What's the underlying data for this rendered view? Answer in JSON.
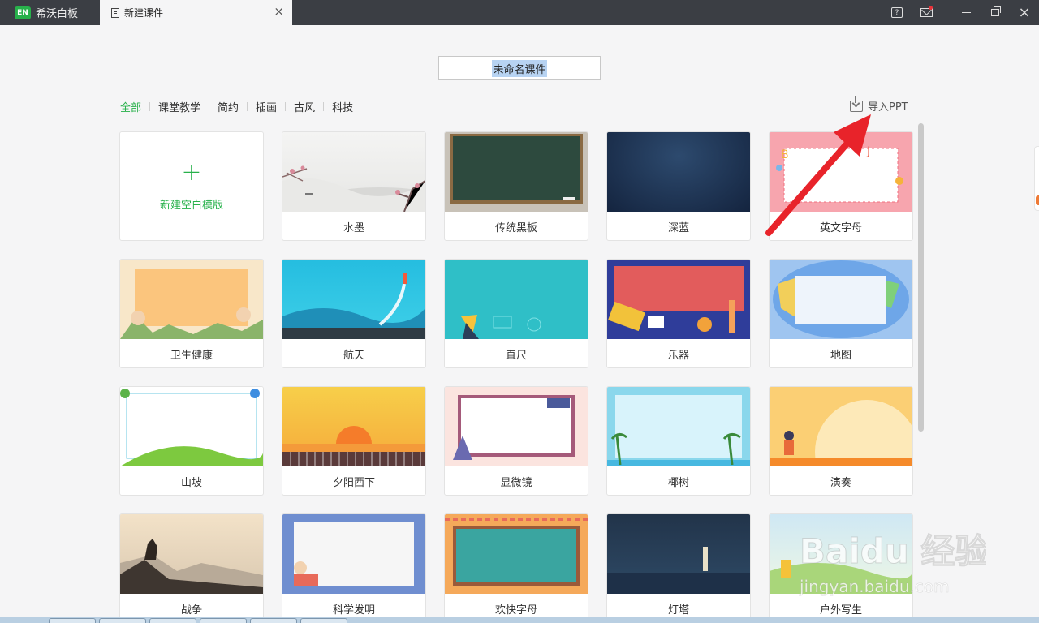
{
  "titlebar": {
    "app_logo": "EN",
    "app_name": "希沃白板",
    "doc_tab": "新建课件",
    "close_glyph": "×",
    "help_glyph": "?"
  },
  "name_input": {
    "value": "未命名课件"
  },
  "categories": [
    "全部",
    "课堂教学",
    "简约",
    "插画",
    "古风",
    "科技"
  ],
  "import_label": "导入PPT",
  "new_template": {
    "plus": "+",
    "label": "新建空白模版"
  },
  "templates": [
    "水墨",
    "传统黑板",
    "深蓝",
    "英文字母",
    "卫生健康",
    "航天",
    "直尺",
    "乐器",
    "地图",
    "山坡",
    "夕阳西下",
    "显微镜",
    "椰树",
    "演奏",
    "战争",
    "科学发明",
    "欢快字母",
    "灯塔",
    "户外写生"
  ],
  "watermark": {
    "brand": "Baidu 经验",
    "url": "jingyan.baidu.com"
  },
  "colors": {
    "accent": "#28b14b",
    "titlebar": "#3b3e44",
    "arrow": "#e8232a"
  }
}
